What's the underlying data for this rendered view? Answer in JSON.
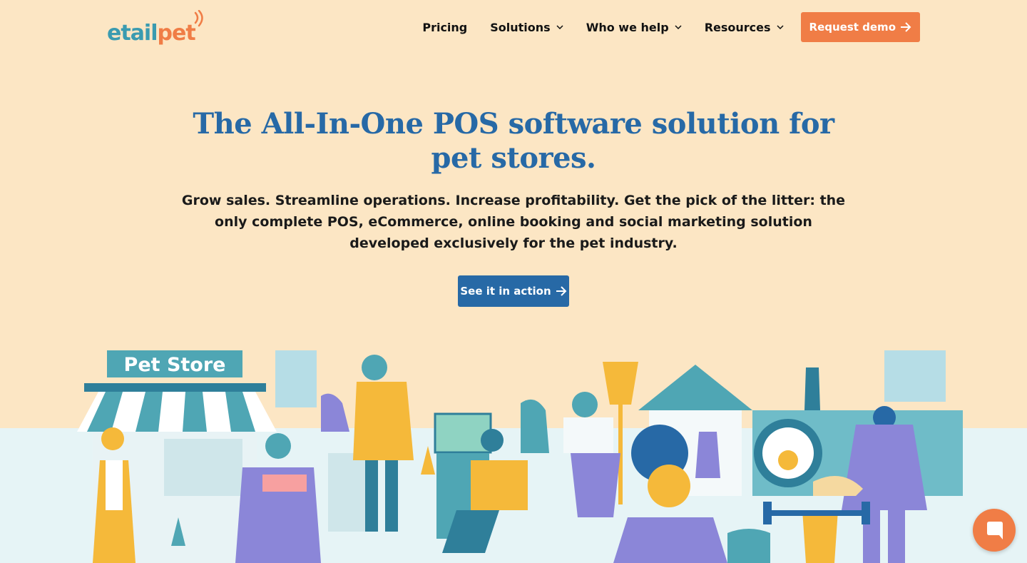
{
  "header": {
    "logo": {
      "part1": "etail",
      "part2": "pet"
    },
    "nav": [
      {
        "label": "Pricing",
        "dropdown": false
      },
      {
        "label": "Solutions",
        "dropdown": true
      },
      {
        "label": "Who we help",
        "dropdown": true
      },
      {
        "label": "Resources",
        "dropdown": true
      }
    ],
    "cta_label": "Request demo"
  },
  "hero": {
    "title_line1": "The All-In-One POS software solution for",
    "title_line2": "pet stores.",
    "subtitle": "Grow sales. Streamline operations. Increase profitability. Get the pick of the litter: the only complete POS, eCommerce, online booking and social marketing solution developed exclusively for the pet industry.",
    "button_label": "See it in action"
  },
  "illustration": {
    "store_sign": "Pet Store"
  },
  "colors": {
    "background": "#fce6c4",
    "brand_blue": "#2769a6",
    "brand_orange": "#f07d46",
    "brand_teal": "#3a9bb0"
  },
  "icons": [
    "chevron-down-icon",
    "arrow-right-icon",
    "chat-icon"
  ]
}
